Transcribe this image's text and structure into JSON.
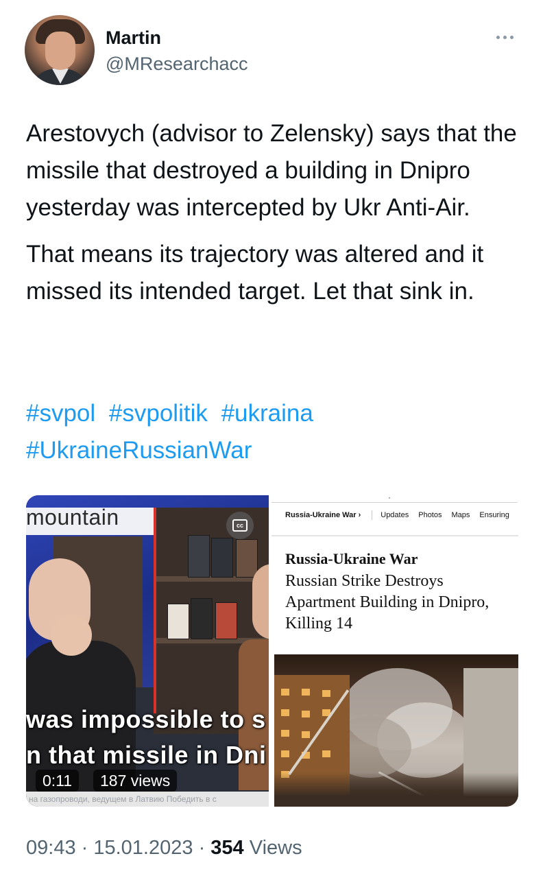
{
  "author": {
    "name": "Martin",
    "handle": "@MResearchacc"
  },
  "tweet": {
    "paragraph1": "Arestovych (advisor to Zelensky) says that the missile that destroyed a building in Dnipro yesterday was intercepted by Ukr Anti-Air.",
    "paragraph2": "That means its trajectory was altered and it missed its intended target. Let that sink in.",
    "hashtags": [
      "#svpol",
      "#svpolitik",
      "#ukraina",
      "#UkraineRussianWar"
    ]
  },
  "video": {
    "top_word": "mountain",
    "subtitle_line1": "was impossible to s",
    "subtitle_line2": "n that missile in Dni",
    "duration": "0:11",
    "views": "187 views",
    "ticker": "на газопроводи, ведущем в Латвию   Победить в с"
  },
  "article": {
    "nav_main": "Russia-Ukraine War ›",
    "nav_items": [
      "Updates",
      "Photos",
      "Maps",
      "Ensuring"
    ],
    "kicker": "Russia-Ukraine War",
    "headline": "Russian Strike Destroys Apartment Building in Dnipro, Killing 14"
  },
  "meta": {
    "time": "09:43",
    "date": "15.01.2023",
    "views_count": "354",
    "views_label": "Views"
  },
  "icons": {
    "more": "more-horizontal-icon",
    "captions": "closed-captions-icon"
  }
}
